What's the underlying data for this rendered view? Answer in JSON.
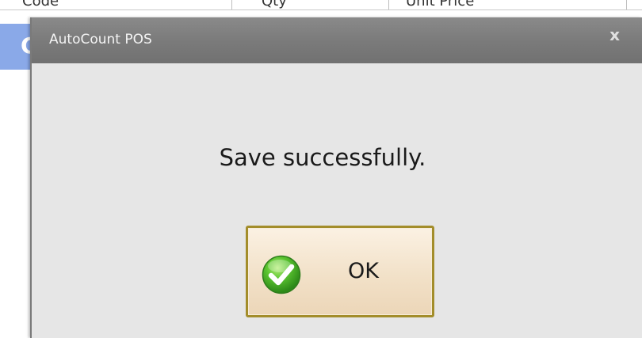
{
  "background": {
    "columns": [
      "Code",
      "Qty",
      "Unit Price"
    ],
    "selected_row_text": "C"
  },
  "dialog": {
    "title": "AutoCount POS",
    "close_glyph": "x",
    "message": "Save successfully.",
    "ok_button": {
      "label": "OK",
      "icon": "check-icon"
    }
  },
  "colors": {
    "titlebar": "#7b7b7b",
    "dialog_body": "#e6e6e6",
    "selected_row": "#8aa9e8",
    "button_border": "#a38d2a",
    "button_fill": "#f2e1c8",
    "check_green": "#3fae2a"
  }
}
